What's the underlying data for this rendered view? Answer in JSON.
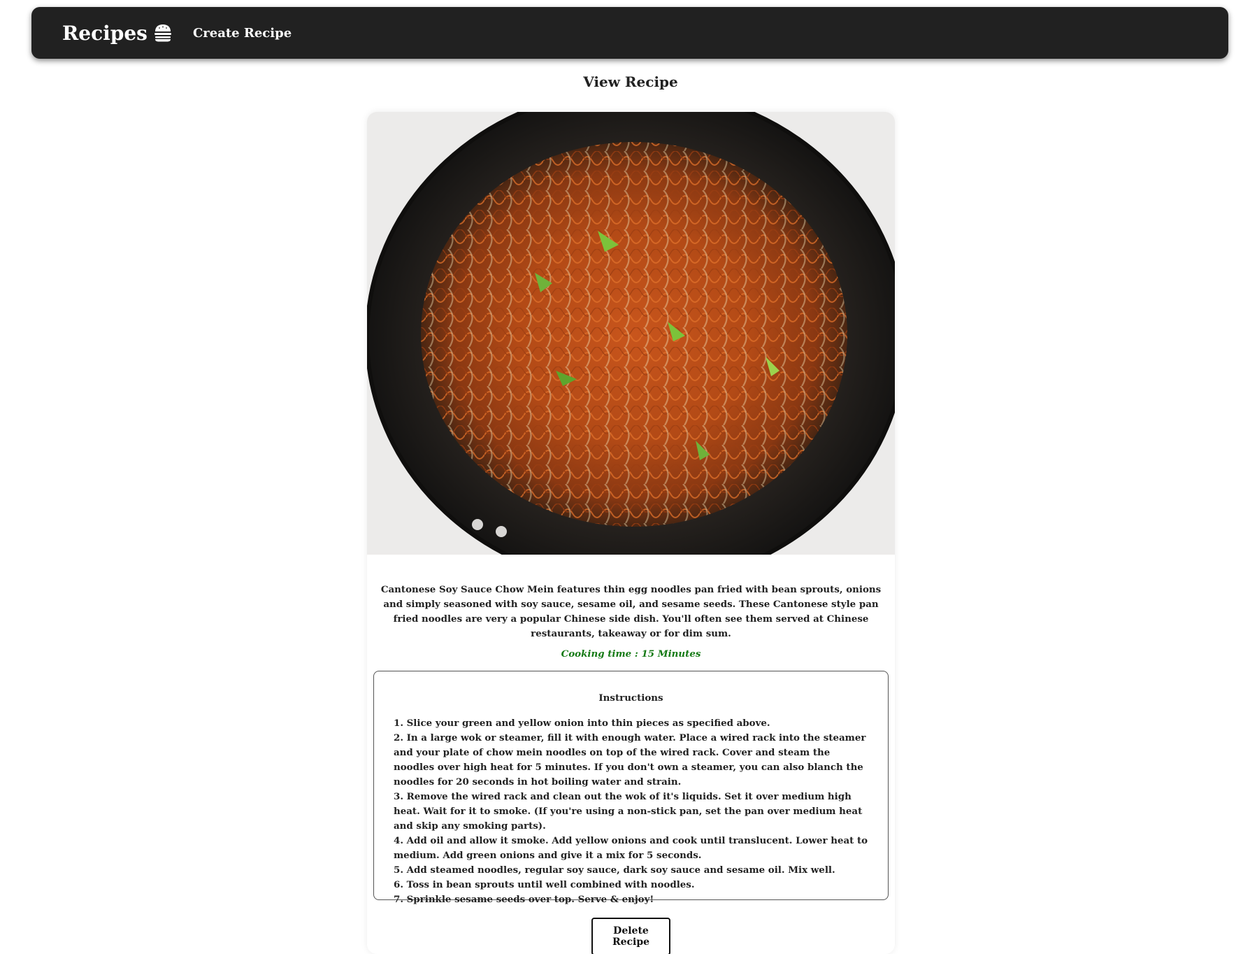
{
  "navbar": {
    "brand": "Recipes",
    "brand_icon": "burger-icon",
    "create_link": "Create Recipe"
  },
  "page": {
    "title": "View Recipe"
  },
  "recipe": {
    "image_alt": "Cantonese soy sauce chow mein in a wok",
    "description": "Cantonese Soy Sauce Chow Mein features thin egg noodles pan fried with bean sprouts, onions and simply seasoned with soy sauce, sesame oil, and sesame seeds. These Cantonese style pan fried noodles are very a popular Chinese side dish. You'll often see them served at Chinese restaurants, takeaway or for dim sum.",
    "cooking_time": "Cooking time : 15 Minutes",
    "instructions_title": "Instructions",
    "instructions": [
      "1. Slice your green and yellow onion into thin pieces as specified above.",
      "2. In a large wok or steamer, fill it with enough water. Place a wired rack into the steamer and your plate of chow mein noodles on top of the wired rack. Cover and steam the noodles over high heat for 5 minutes. If you don't own a steamer, you can also blanch the noodles for 20 seconds in hot boiling water and strain.",
      "3. Remove the wired rack and clean out the wok of it's liquids. Set it over medium high heat. Wait for it to smoke. (If you're using a non-stick pan, set the pan over medium heat and skip any smoking parts).",
      "4. Add oil and allow it smoke. Add yellow onions and cook until translucent. Lower heat to medium. Add green onions and give it a mix for 5 seconds.",
      "5. Add steamed noodles, regular soy sauce, dark soy sauce and sesame oil. Mix well.",
      "6. Toss in bean sprouts until well combined with noodles.",
      "7. Sprinkle sesame seeds over top. Serve & enjoy!"
    ],
    "delete_label": "Delete Recipe"
  },
  "colors": {
    "navbar_bg": "#212121",
    "cooking_time": "#157a15"
  }
}
